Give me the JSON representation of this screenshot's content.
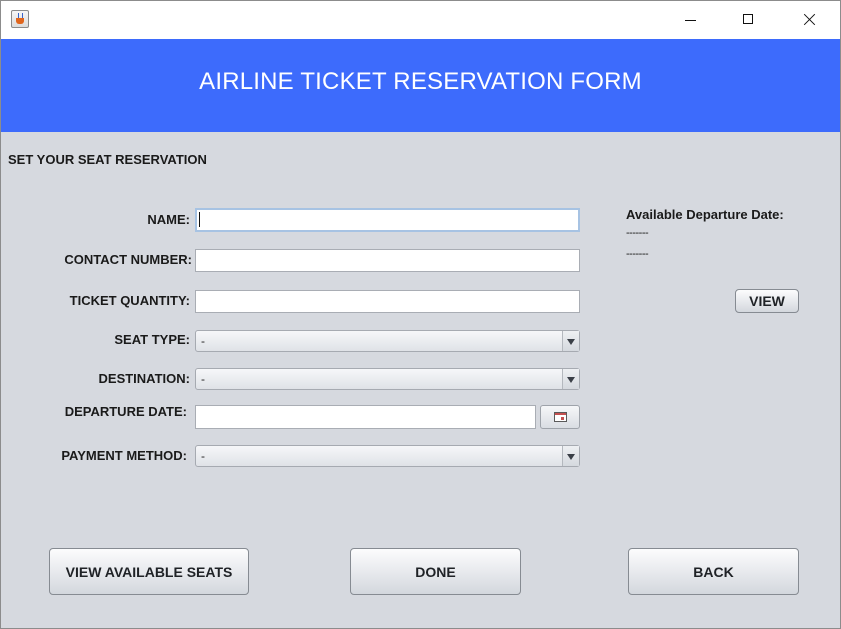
{
  "header": {
    "title": "AIRLINE TICKET RESERVATION FORM"
  },
  "form": {
    "section_title": "SET YOUR SEAT RESERVATION",
    "name": {
      "label": "NAME:",
      "value": ""
    },
    "contact_number": {
      "label": "CONTACT NUMBER:",
      "value": ""
    },
    "ticket_quantity": {
      "label": "TICKET QUANTITY:",
      "value": ""
    },
    "seat_type": {
      "label": "SEAT TYPE:",
      "selected": "-"
    },
    "destination": {
      "label": "DESTINATION:",
      "selected": "-"
    },
    "departure_date": {
      "label": "DEPARTURE DATE:",
      "value": ""
    },
    "payment_method": {
      "label": "PAYMENT METHOD:",
      "selected": "-"
    }
  },
  "side_panel": {
    "title": "Available Departure Date:",
    "lines": [
      "-------",
      "-------"
    ],
    "view_label": "VIEW"
  },
  "buttons": {
    "view_seats": "VIEW AVAILABLE SEATS",
    "done": "DONE",
    "back": "BACK"
  },
  "colors": {
    "header_bg": "#3d6bfc",
    "panel_bg": "#d6d9df",
    "header_text": "#ffffff"
  },
  "icons": {
    "app": "java-cup-icon",
    "minimize": "minimize-icon",
    "maximize": "maximize-icon",
    "close": "close-icon",
    "date_picker": "calendar-icon"
  }
}
